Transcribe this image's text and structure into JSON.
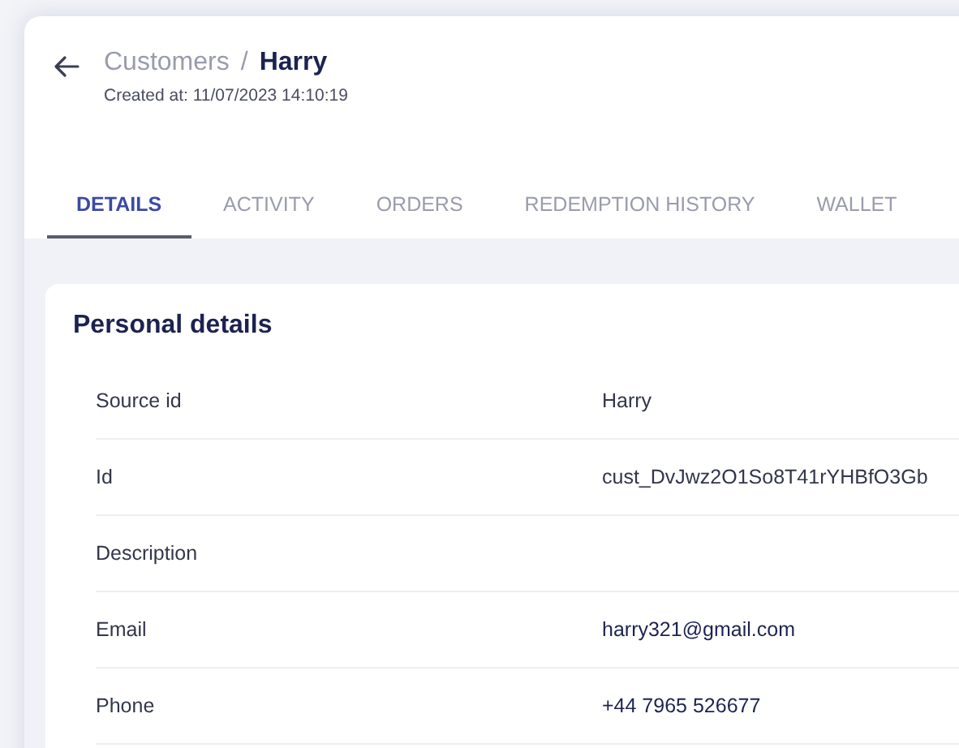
{
  "breadcrumb": {
    "parent": "Customers",
    "separator": "/",
    "current": "Harry"
  },
  "created_at": "Created at: 11/07/2023 14:10:19",
  "tabs": [
    {
      "label": "DETAILS",
      "selected": true
    },
    {
      "label": "ACTIVITY",
      "selected": false
    },
    {
      "label": "ORDERS",
      "selected": false
    },
    {
      "label": "REDEMPTION HISTORY",
      "selected": false
    },
    {
      "label": "WALLET",
      "selected": false
    }
  ],
  "section": {
    "title": "Personal details",
    "rows": [
      {
        "label": "Source id",
        "value": "Harry",
        "kind": "text"
      },
      {
        "label": "Id",
        "value": "cust_DvJwz2O1So8T41rYHBfO3Gb",
        "kind": "text"
      },
      {
        "label": "Description"
      },
      {
        "label": "Email",
        "value": "harry321@gmail.com",
        "kind": "contact"
      },
      {
        "label": "Phone",
        "value": "+44 7965 526677",
        "kind": "contact"
      }
    ]
  }
}
